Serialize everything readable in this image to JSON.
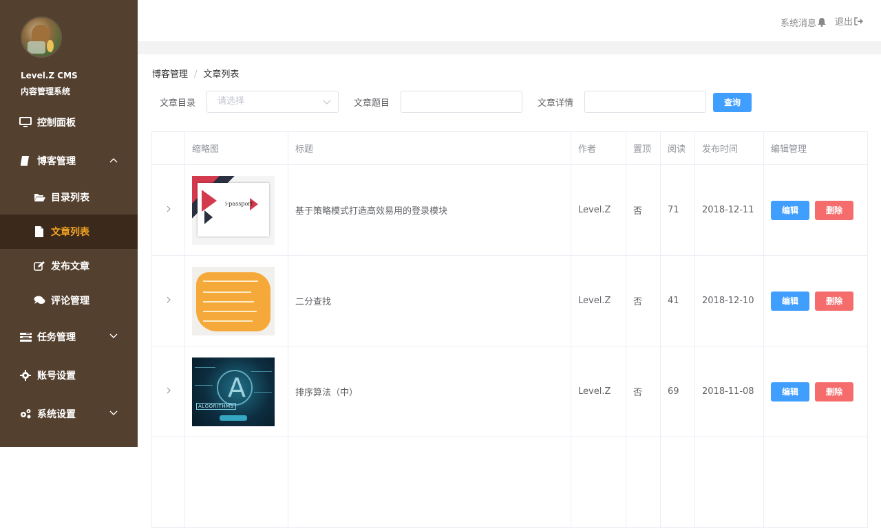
{
  "sidebar": {
    "brand_line1": "Level.Z CMS",
    "brand_line2": "内容管理系统",
    "items": [
      {
        "label": "控制面板",
        "icon": "monitor-icon"
      },
      {
        "label": "博客管理",
        "icon": "book-icon",
        "expanded": true
      },
      {
        "label": "目录列表",
        "icon": "folder-open-icon"
      },
      {
        "label": "文章列表",
        "icon": "file-icon",
        "active": true
      },
      {
        "label": "发布文章",
        "icon": "edit-icon"
      },
      {
        "label": "评论管理",
        "icon": "comments-icon"
      },
      {
        "label": "任务管理",
        "icon": "tasks-icon"
      },
      {
        "label": "账号设置",
        "icon": "gear-icon"
      },
      {
        "label": "系统设置",
        "icon": "gears-icon"
      }
    ],
    "active_color": "#f5a623"
  },
  "header": {
    "messages_label": "系统消息",
    "logout_label": "退出"
  },
  "breadcrumb": {
    "root": "博客管理",
    "separator": "/",
    "current": "文章列表"
  },
  "filters": {
    "category_label": "文章目录",
    "category_placeholder": "请选择",
    "title_label": "文章题目",
    "title_value": "",
    "detail_label": "文章详情",
    "detail_value": "",
    "query_button": "查询"
  },
  "table": {
    "headers": [
      "缩略图",
      "标题",
      "作者",
      "置顶",
      "阅读",
      "发布时间",
      "编辑管理"
    ],
    "rows": [
      {
        "title": "基于策略模式打造高效易用的登录模块",
        "author": "Level.Z",
        "top": "否",
        "reads": "71",
        "date": "2018-12-11",
        "thumb_text": "i-passport"
      },
      {
        "title": "二分查找",
        "author": "Level.Z",
        "top": "否",
        "reads": "41",
        "date": "2018-12-10",
        "thumb_text": ""
      },
      {
        "title": "排序算法（中）",
        "author": "Level.Z",
        "top": "否",
        "reads": "69",
        "date": "2018-11-08",
        "thumb_text": "ALGORITHMS"
      }
    ],
    "edit_label": "编辑",
    "delete_label": "删除"
  },
  "colors": {
    "sidebar_bg": "#54402f",
    "primary": "#409eff",
    "danger": "#f56c6c"
  }
}
